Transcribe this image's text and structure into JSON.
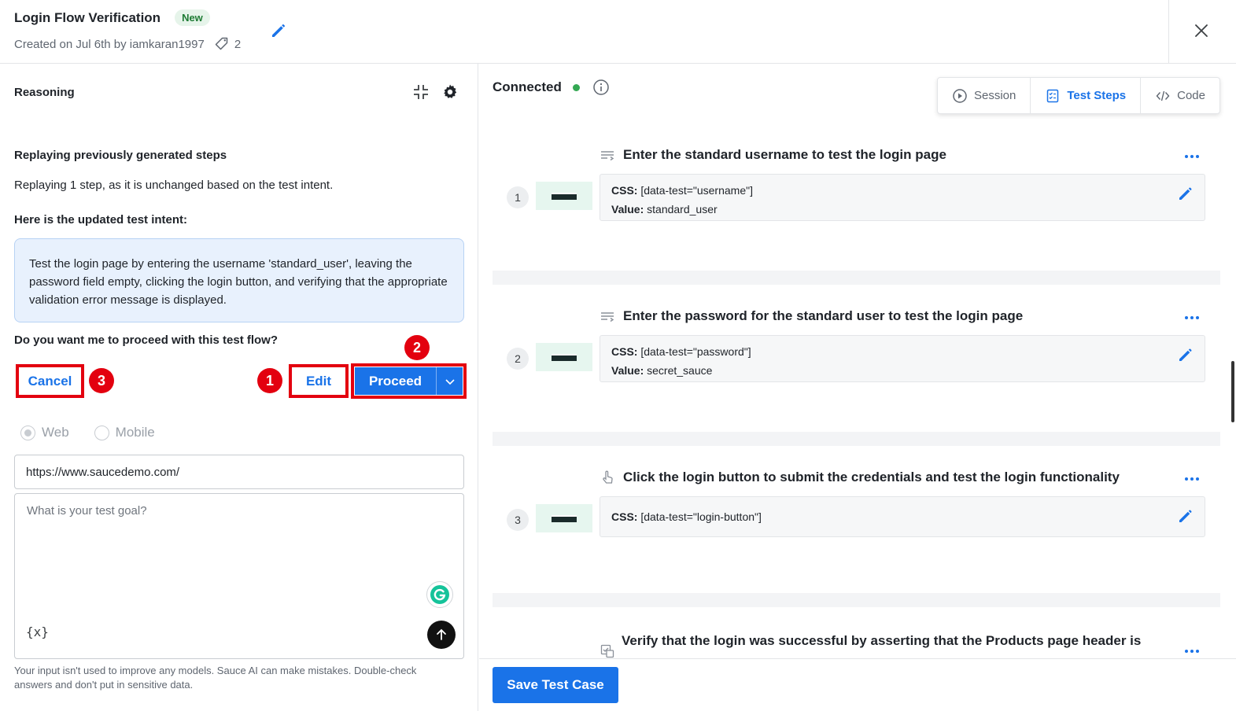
{
  "header": {
    "title": "Login Flow Verification",
    "badge": "New",
    "created_text": "Created on Jul 6th by iamkaran1997",
    "tag_count": "2"
  },
  "left": {
    "section_title": "Reasoning",
    "replay_heading": "Replaying previously generated steps",
    "replay_text": "Replaying 1 step, as it is unchanged based on the test intent.",
    "intent_heading": "Here is the updated test intent:",
    "intent_text": "Test the login page by entering the username 'standard_user', leaving the password field empty, clicking the login button, and verifying that the appropriate validation error message is displayed.",
    "question": "Do you want me to proceed with this test flow?",
    "cancel_label": "Cancel",
    "edit_label": "Edit",
    "proceed_label": "Proceed",
    "markers": {
      "edit": "1",
      "proceed": "2",
      "cancel": "3"
    },
    "platform_options": [
      "Web",
      "Mobile"
    ],
    "selected_platform": "Web",
    "url_value": "https://www.saucedemo.com/",
    "goal_placeholder": "What is your test goal?",
    "variable_label": "{x}",
    "disclaimer": "Your input isn't used to improve any models. Sauce AI can make mistakes. Double-check answers and don't put in sensitive data."
  },
  "right": {
    "connection_status": "Connected",
    "status_color": "#34a853",
    "tabs": [
      {
        "label": "Session",
        "icon": "play-circle-icon"
      },
      {
        "label": "Test Steps",
        "icon": "checklist-icon",
        "active": true
      },
      {
        "label": "Code",
        "icon": "code-icon"
      }
    ],
    "steps": [
      {
        "number": "1",
        "title": "Enter the standard username to test the login page",
        "css": "[data-test=\"username\"]",
        "value": "standard_user"
      },
      {
        "number": "2",
        "title": "Enter the password for the standard user to test the login page",
        "css": "[data-test=\"password\"]",
        "value": "secret_sauce"
      },
      {
        "number": "3",
        "title": "Click the login button to submit the credentials and test the login functionality",
        "css": "[data-test=\"login-button\"]"
      },
      {
        "title": "Verify that the login was successful by asserting that the Products page header is"
      }
    ],
    "css_label": "CSS:",
    "value_label": "Value:",
    "save_label": "Save Test Case"
  },
  "colors": {
    "accent": "#1a73e8",
    "highlight": "#e3000f",
    "badge_bg": "#e6f4ea"
  }
}
